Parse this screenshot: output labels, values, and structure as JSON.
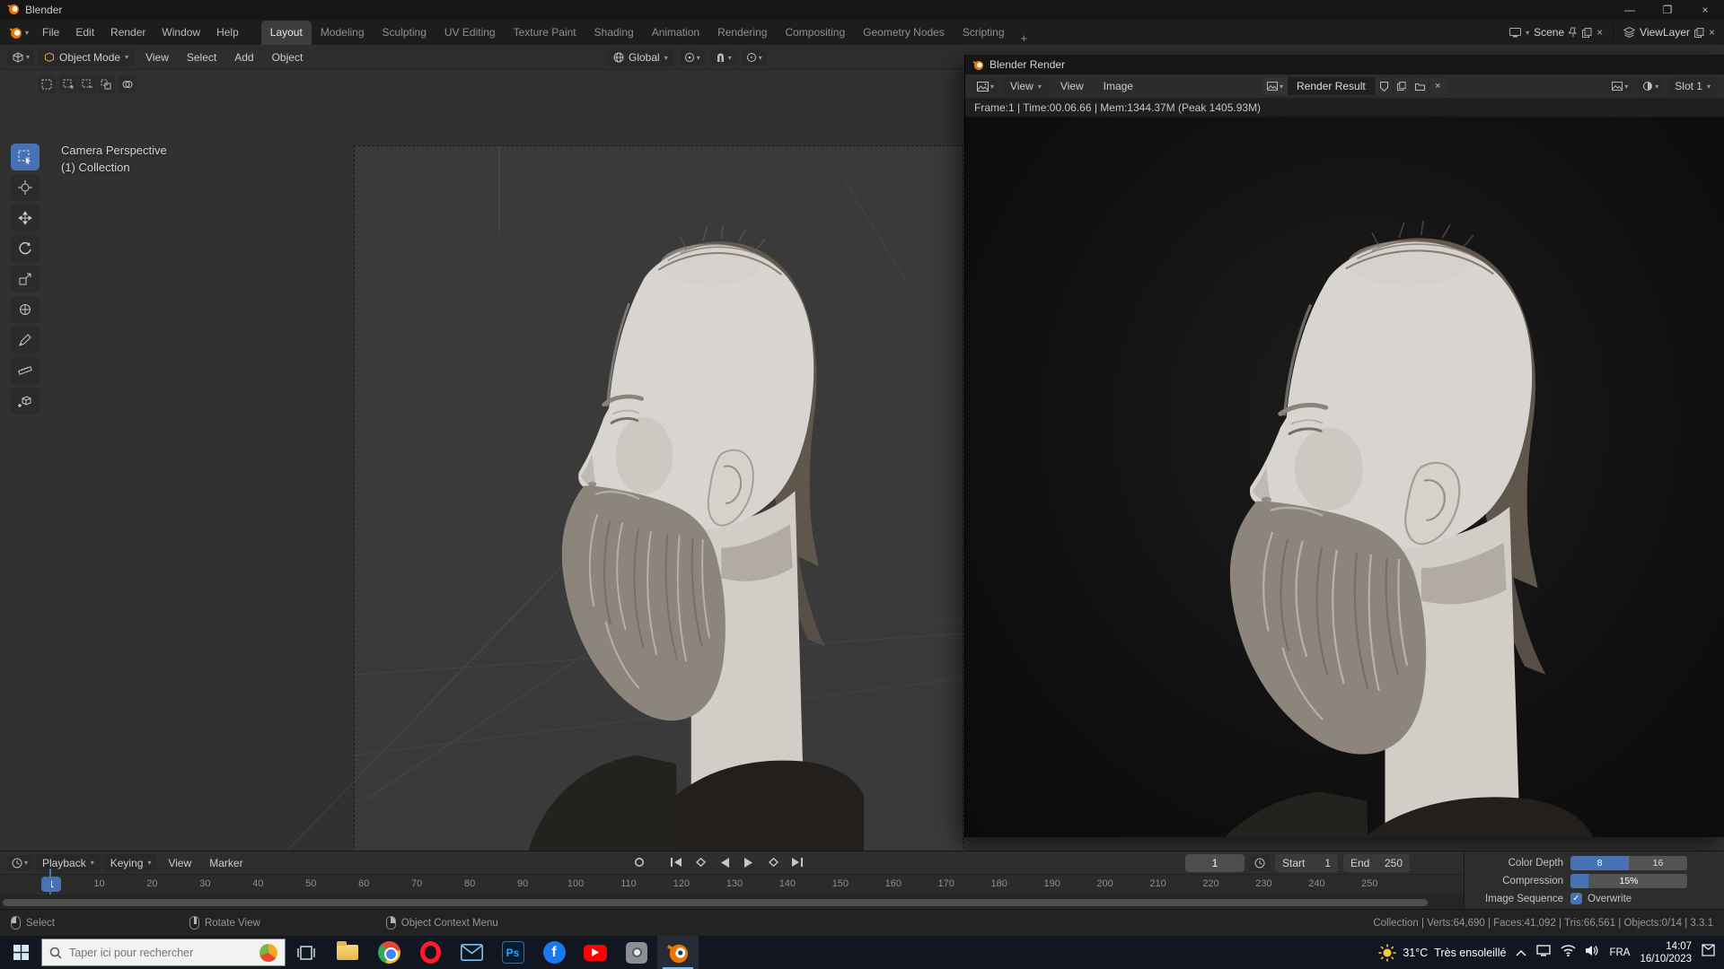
{
  "os": {
    "window_title": "Blender"
  },
  "topbar": {
    "menus": [
      "File",
      "Edit",
      "Render",
      "Window",
      "Help"
    ],
    "tabs": [
      "Layout",
      "Modeling",
      "Sculpting",
      "UV Editing",
      "Texture Paint",
      "Shading",
      "Animation",
      "Rendering",
      "Compositing",
      "Geometry Nodes",
      "Scripting"
    ],
    "active_tab": "Layout",
    "new_tab": "+",
    "scene": "Scene",
    "view_layer": "ViewLayer"
  },
  "viewport": {
    "mode": "Object Mode",
    "menus": [
      "View",
      "Select",
      "Add",
      "Object"
    ],
    "orientation": "Global",
    "overlay_line1": "Camera Perspective",
    "overlay_line2": "(1) Collection"
  },
  "render_window": {
    "title": "Blender Render",
    "mode": "View",
    "menus": [
      "View",
      "Image"
    ],
    "datablock": "Render Result",
    "slot": "Slot 1",
    "stats": "Frame:1 | Time:00.06.66 | Mem:1344.37M (Peak 1405.93M)"
  },
  "timeline": {
    "menus": [
      "Playback",
      "Keying",
      "View",
      "Marker"
    ],
    "current_frame": "1",
    "playhead_label": "1",
    "start_label": "Start",
    "start_value": "1",
    "end_label": "End",
    "end_value": "250",
    "ticks": [
      "10",
      "20",
      "30",
      "40",
      "50",
      "60",
      "70",
      "80",
      "90",
      "100",
      "110",
      "120",
      "130",
      "140",
      "150",
      "160",
      "170",
      "180",
      "190",
      "200",
      "210",
      "220",
      "230",
      "240",
      "250"
    ]
  },
  "output_props": {
    "color_depth_label": "Color Depth",
    "depth_8": "8",
    "depth_16": "16",
    "compression_label": "Compression",
    "compression_value": "15%",
    "compression_percent": 15,
    "image_sequence_label": "Image Sequence",
    "overwrite_label": "Overwrite"
  },
  "status_bar": {
    "keymap": [
      {
        "label": "Select"
      },
      {
        "label": "Rotate View"
      },
      {
        "label": "Object Context Menu"
      }
    ],
    "stats": "Collection | Verts:64,690 | Faces:41,092 | Tris:66,561 | Objects:0/14 | 3.3.1"
  },
  "taskbar": {
    "search_placeholder": "Taper ici pour rechercher",
    "weather_temp": "31°C",
    "weather_desc": "Très ensoleillé",
    "language": "FRA",
    "time": "14:07",
    "date": "16/10/2023"
  },
  "colors": {
    "accent": "#4772b3",
    "blender_orange": "#ea7600"
  },
  "icons": {
    "toolbar": [
      "box-select",
      "cursor",
      "move",
      "rotate",
      "scale",
      "transform",
      "annotate",
      "measure",
      "add-cube"
    ],
    "transport": [
      "record",
      "jump-to-start",
      "previous-keyframe",
      "play-reverse",
      "play",
      "next-keyframe",
      "jump-to-end"
    ],
    "taskbar": [
      "start",
      "task-view",
      "file-explorer",
      "chrome",
      "opera",
      "mail",
      "photoshop",
      "facebook",
      "youtube",
      "screenshot-tool",
      "blender"
    ],
    "tray": [
      "tray-expand",
      "network",
      "wifi",
      "volume",
      "notifications"
    ]
  }
}
